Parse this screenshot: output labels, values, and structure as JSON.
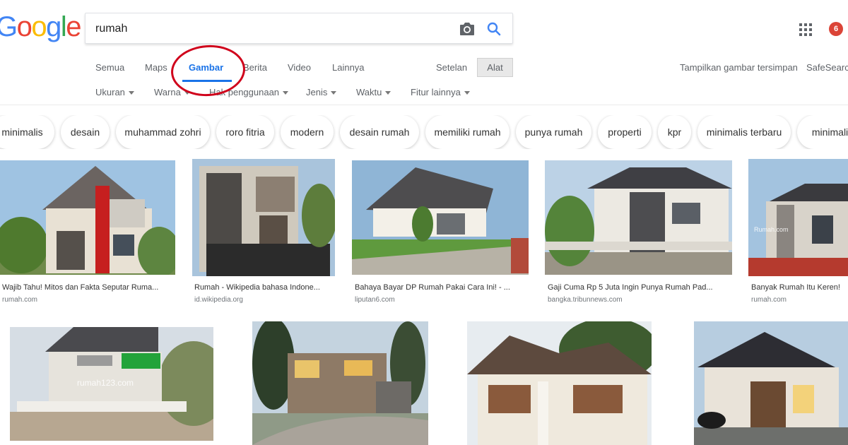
{
  "logo": {
    "letters": [
      "G",
      "o",
      "o",
      "g",
      "l",
      "e"
    ],
    "colors": [
      "#4285f4",
      "#ea4335",
      "#fbbc05",
      "#4285f4",
      "#34a853",
      "#ea4335"
    ]
  },
  "search": {
    "value": "rumah"
  },
  "icons": {
    "camera": "camera-icon",
    "search": "search-icon",
    "apps": "apps-grid-icon"
  },
  "notifications": {
    "count": "6"
  },
  "tabs": {
    "all": "Semua",
    "maps": "Maps",
    "images": "Gambar",
    "news": "Berita",
    "videos": "Video",
    "more": "Lainnya",
    "settings": "Setelan",
    "tools": "Alat"
  },
  "right_links": {
    "saved_images": "Tampilkan gambar tersimpan",
    "safesearch": "SafeSearch"
  },
  "filters": {
    "size": "Ukuran",
    "color": "Warna",
    "usage": "Hak penggunaan",
    "type": "Jenis",
    "time": "Waktu",
    "more_tools": "Fitur lainnya"
  },
  "chips": [
    "minimalis",
    "desain",
    "muhammad zohri",
    "roro fitria",
    "modern",
    "desain rumah",
    "memiliki rumah",
    "punya rumah",
    "properti",
    "kpr",
    "minimalis terbaru",
    "minimalis"
  ],
  "results_row1": [
    {
      "caption": "Wajib Tahu! Mitos dan Fakta Seputar Ruma...",
      "source": "rumah.com"
    },
    {
      "caption": "Rumah - Wikipedia bahasa Indone...",
      "source": "id.wikipedia.org"
    },
    {
      "caption": "Bahaya Bayar DP Rumah Pakai Cara Ini! - ...",
      "source": "liputan6.com"
    },
    {
      "caption": "Gaji Cuma Rp 5 Juta Ingin Punya Rumah Pad...",
      "source": "bangka.tribunnews.com"
    },
    {
      "caption": "Banyak Rumah Itu Keren!",
      "source": "rumah.com"
    }
  ],
  "watermarks": {
    "rumah123": "rumah123.com",
    "rumahcom": "Rumah.com"
  },
  "colors": {
    "accent": "#1a73e8",
    "highlight_circle": "#d0021b",
    "badge": "#db4437"
  }
}
